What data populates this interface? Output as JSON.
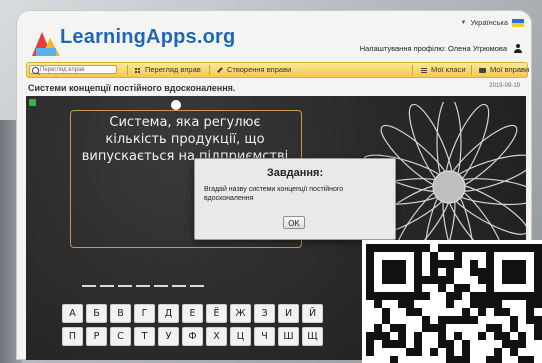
{
  "header": {
    "logo_text": "LearningApps.org",
    "language": "Українська",
    "profile_text": "Налаштування профілю: Олена Угрюмова"
  },
  "nav": {
    "search_placeholder": "Перегляд вправ",
    "items": [
      {
        "label": "Перегляд вправ",
        "icon": "grid-icon"
      },
      {
        "label": "Створення вправи",
        "icon": "pencil-icon"
      },
      {
        "label": "Мої класи",
        "icon": "list-icon"
      },
      {
        "label": "Мої вправи",
        "icon": "folder-icon"
      }
    ]
  },
  "page": {
    "title": "Системи концепції постійного вдосконалення.",
    "date": "2019-09-19"
  },
  "app": {
    "question": "Система, яка регулює кількість продукції, що випускається на підприємстві",
    "modal": {
      "title": "Завдання:",
      "text": "Вгадай назву системи концепції постійного вдосконалення",
      "ok_label": "OK"
    },
    "slot_count": 7,
    "keyboard_rows": [
      [
        "А",
        "Б",
        "В",
        "Г",
        "Д",
        "Е",
        "Ё",
        "Ж",
        "З",
        "И",
        "Й"
      ],
      [
        "П",
        "Р",
        "С",
        "Т",
        "У",
        "Ф",
        "Х",
        "Ц",
        "Ч",
        "Ш",
        "Щ"
      ]
    ]
  },
  "colors": {
    "brand_blue": "#1f66b8",
    "nav_yellow": "#f4c94c",
    "chalkboard": "#2b2b2b",
    "card_border": "#c79a53"
  }
}
